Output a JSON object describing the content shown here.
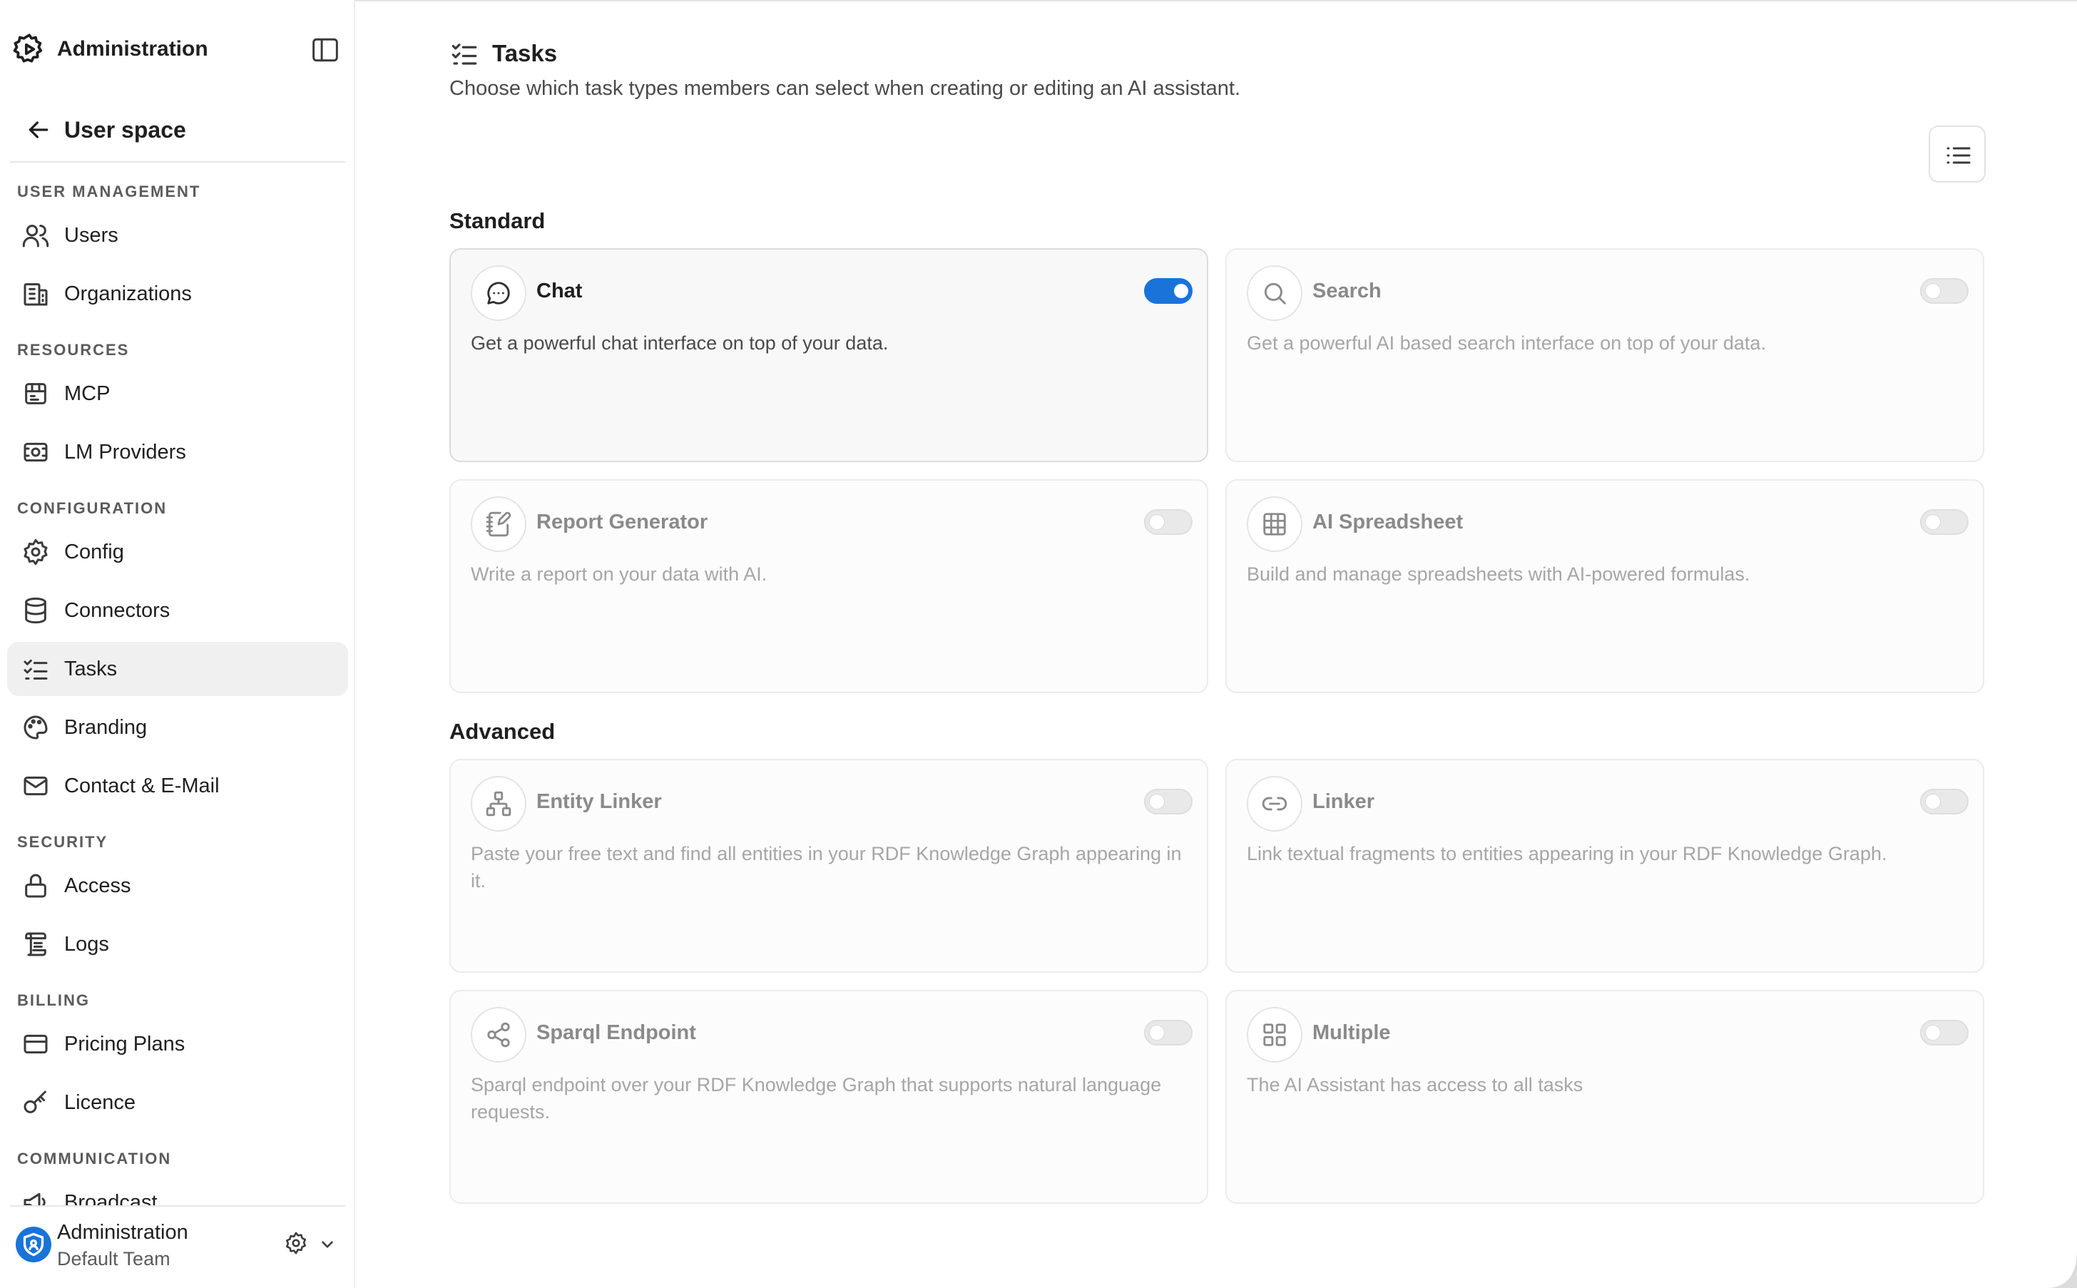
{
  "sidebar": {
    "header_title": "Administration",
    "back_label": "User space",
    "sections": {
      "user_management": "USER MANAGEMENT",
      "resources": "RESOURCES",
      "configuration": "CONFIGURATION",
      "security": "SECURITY",
      "billing": "BILLING",
      "communication": "COMMUNICATION"
    },
    "items": {
      "users": "Users",
      "organizations": "Organizations",
      "mcp": "MCP",
      "lm_providers": "LM Providers",
      "config": "Config",
      "connectors": "Connectors",
      "tasks": "Tasks",
      "branding": "Branding",
      "contact": "Contact & E-Mail",
      "access": "Access",
      "logs": "Logs",
      "pricing": "Pricing Plans",
      "licence": "Licence",
      "broadcast": "Broadcast"
    },
    "active_item": "Tasks",
    "footer": {
      "name": "Administration",
      "team": "Default Team"
    }
  },
  "page": {
    "title": "Tasks",
    "subtitle": "Choose which task types members can select when creating or editing an AI assistant."
  },
  "groups": {
    "standard": "Standard",
    "advanced": "Advanced"
  },
  "cards": {
    "chat": {
      "name": "Chat",
      "desc": "Get a powerful chat interface on top of your data.",
      "enabled": true
    },
    "search": {
      "name": "Search",
      "desc": "Get a powerful AI based search interface on top of your data.",
      "enabled": false
    },
    "report": {
      "name": "Report Generator",
      "desc": "Write a report on your data with AI.",
      "enabled": false
    },
    "spreadsheet": {
      "name": "AI Spreadsheet",
      "desc": "Build and manage spreadsheets with AI-powered formulas.",
      "enabled": false
    },
    "entity_linker": {
      "name": "Entity Linker",
      "desc": "Paste your free text and find all entities in your RDF Knowledge Graph appearing in it.",
      "enabled": false
    },
    "linker": {
      "name": "Linker",
      "desc": "Link textual fragments to entities appearing in your RDF Knowledge Graph.",
      "enabled": false
    },
    "sparql": {
      "name": "Sparql Endpoint",
      "desc": "Sparql endpoint over your RDF Knowledge Graph that supports natural language requests.",
      "enabled": false
    },
    "multiple": {
      "name": "Multiple",
      "desc": "The AI Assistant has access to all tasks",
      "enabled": false
    }
  },
  "colors": {
    "accent": "#1a73d9",
    "border": "#ececec",
    "muted_text": "#a6a6a6"
  }
}
